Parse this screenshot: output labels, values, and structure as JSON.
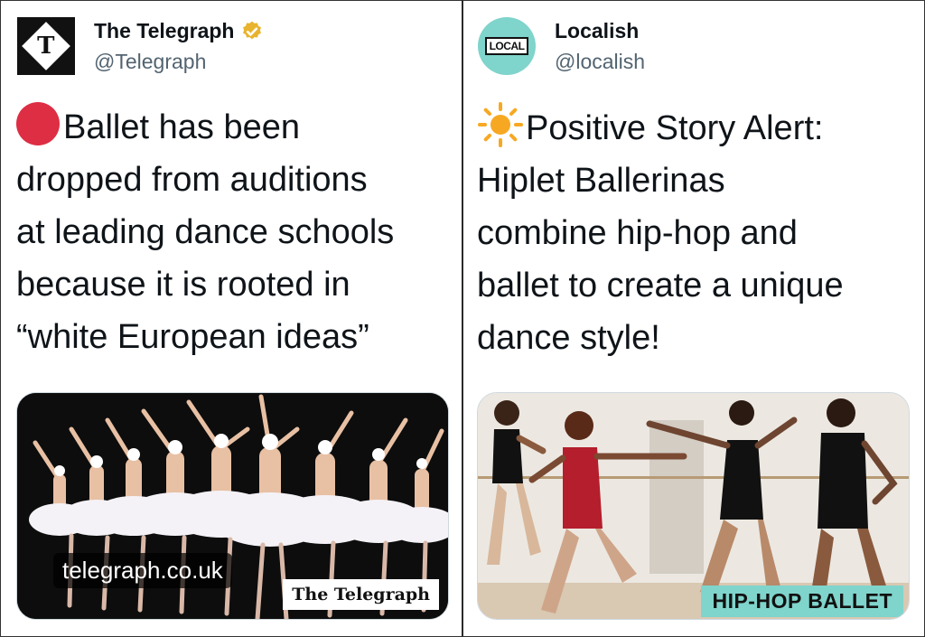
{
  "left": {
    "account": {
      "name": "The Telegraph",
      "handle": "@Telegraph",
      "verified": true,
      "avatar_icon": "telegraph-logo-icon",
      "avatar_letter": "T"
    },
    "text": "Ballet has been\ndropped from auditions\nat leading dance schools\nbecause it is rooted in\n“white European ideas”",
    "emoji": "red-circle-icon",
    "media": {
      "link_chip": "telegraph.co.uk",
      "watermark": "The Telegraph",
      "scene": "ballet-dancers-swan-lake"
    }
  },
  "right": {
    "account": {
      "name": "Localish",
      "handle": "@localish",
      "avatar_icon": "localish-logo-icon",
      "avatar_logo_text": "LOCAL"
    },
    "text": "Positive Story Alert:\nHiplet Ballerinas\ncombine hip-hop and\nballet to create a unique\ndance style!",
    "emoji": "sun-icon",
    "media": {
      "overlay_label": "HIP-HOP BALLET",
      "scene": "hiplet-dancers-studio"
    }
  },
  "colors": {
    "verified_gold": "#e8b32e",
    "localish_teal": "#7fd4cc",
    "red_dot": "#dd2e44",
    "sun": "#f7a823"
  }
}
